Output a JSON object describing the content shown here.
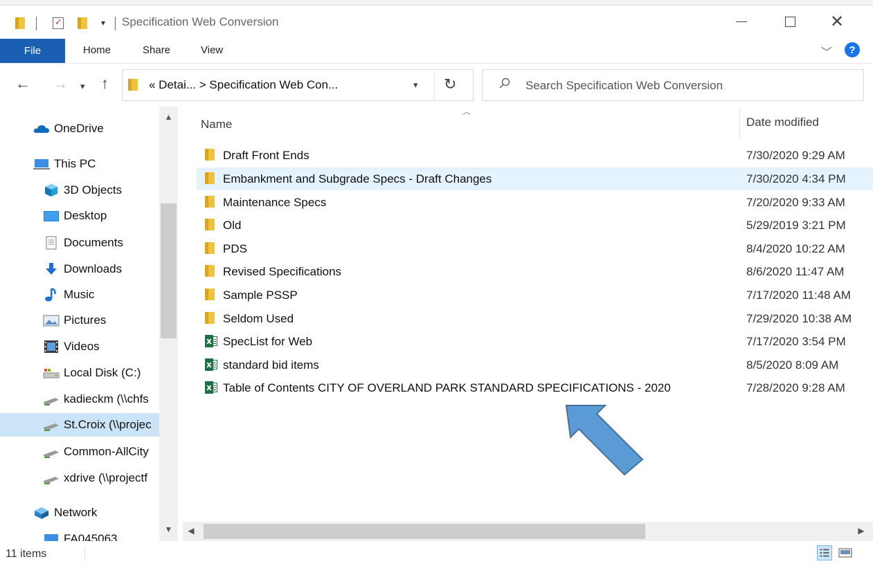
{
  "window": {
    "title": "Specification Web Conversion"
  },
  "ribbon": {
    "tabs": [
      "File",
      "Home",
      "Share",
      "View"
    ]
  },
  "address": {
    "crumbs": "«  Detai...  >  Specification Web Con..."
  },
  "search": {
    "placeholder": "Search Specification Web Conversion"
  },
  "nav": {
    "items": [
      {
        "label": "OneDrive",
        "icon": "cloud-icon"
      },
      {
        "label": "This PC",
        "icon": "computer-icon"
      },
      {
        "label": "3D Objects",
        "icon": "cube-icon"
      },
      {
        "label": "Desktop",
        "icon": "desktop-icon"
      },
      {
        "label": "Documents",
        "icon": "document-icon"
      },
      {
        "label": "Downloads",
        "icon": "download-icon"
      },
      {
        "label": "Music",
        "icon": "music-icon"
      },
      {
        "label": "Pictures",
        "icon": "pictures-icon"
      },
      {
        "label": "Videos",
        "icon": "videos-icon"
      },
      {
        "label": "Local Disk (C:)",
        "icon": "disk-icon"
      },
      {
        "label": "kadieckm (\\\\chfs",
        "icon": "network-drive-icon"
      },
      {
        "label": "St.Croix (\\\\projec",
        "icon": "network-drive-icon"
      },
      {
        "label": "Common-AllCity",
        "icon": "network-drive-icon"
      },
      {
        "label": "xdrive (\\\\projectf",
        "icon": "network-drive-icon"
      },
      {
        "label": "Network",
        "icon": "network-icon"
      },
      {
        "label": "FA045063",
        "icon": "computer-icon"
      }
    ]
  },
  "columns": {
    "name": "Name",
    "date": "Date modified"
  },
  "files": [
    {
      "name": "Draft Front Ends",
      "date": "7/30/2020 9:29 AM",
      "type": "folder"
    },
    {
      "name": "Embankment and Subgrade Specs - Draft Changes",
      "date": "7/30/2020 4:34 PM",
      "type": "folder"
    },
    {
      "name": "Maintenance Specs",
      "date": "7/20/2020 9:33 AM",
      "type": "folder"
    },
    {
      "name": "Old",
      "date": "5/29/2019 3:21 PM",
      "type": "folder"
    },
    {
      "name": "PDS",
      "date": "8/4/2020 10:22 AM",
      "type": "folder"
    },
    {
      "name": "Revised Specifications",
      "date": "8/6/2020 11:47 AM",
      "type": "folder"
    },
    {
      "name": "Sample PSSP",
      "date": "7/17/2020 11:48 AM",
      "type": "folder"
    },
    {
      "name": "Seldom Used",
      "date": "7/29/2020 10:38 AM",
      "type": "folder"
    },
    {
      "name": "SpecList for Web",
      "date": "7/17/2020 3:54 PM",
      "type": "excel"
    },
    {
      "name": "standard bid items",
      "date": "8/5/2020 8:09 AM",
      "type": "excel"
    },
    {
      "name": "Table of Contents CITY OF OVERLAND PARK STANDARD SPECIFICATIONS - 2020",
      "date": "7/28/2020 9:28 AM",
      "type": "excel"
    }
  ],
  "status": {
    "count": "11 items"
  },
  "colors": {
    "accent": "#1a5fb4",
    "selection": "#cce4f7",
    "hover": "#e5f3ff",
    "folder": "#f0c33c",
    "excel": "#1e7145",
    "annotation_arrow": "#5b9bd5"
  }
}
